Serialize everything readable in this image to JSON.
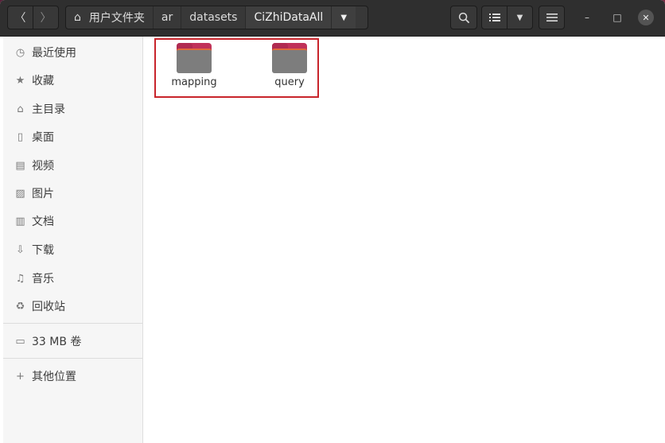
{
  "window": {
    "nav": {
      "back_icon": "chevron-left-icon",
      "forward_icon": "chevron-right-icon"
    },
    "pathbar": {
      "crumbs": [
        {
          "label": "用户文件夹",
          "icon": "home-icon"
        },
        {
          "label": "ar"
        },
        {
          "label": "datasets"
        },
        {
          "label": "CiZhiDataAll"
        }
      ],
      "dropdown_icon": "chevron-down-icon"
    },
    "toolbar": {
      "search_icon": "search-icon",
      "view_icon": "list-view-icon",
      "view_dropdown_icon": "chevron-down-icon",
      "menu_icon": "hamburger-menu-icon"
    },
    "controls": {
      "minimize": "–",
      "maximize": "□",
      "close": "✕"
    }
  },
  "sidebar": {
    "items": [
      {
        "label": "最近使用",
        "icon": "clock-icon"
      },
      {
        "label": "收藏",
        "icon": "star-icon"
      },
      {
        "label": "主目录",
        "icon": "home-icon"
      },
      {
        "label": "桌面",
        "icon": "desktop-icon"
      },
      {
        "label": "视频",
        "icon": "video-icon"
      },
      {
        "label": "图片",
        "icon": "image-icon"
      },
      {
        "label": "文档",
        "icon": "document-icon"
      },
      {
        "label": "下载",
        "icon": "download-icon"
      },
      {
        "label": "音乐",
        "icon": "music-icon"
      },
      {
        "label": "回收站",
        "icon": "trash-icon"
      }
    ],
    "volume": {
      "label": "33 MB 卷",
      "icon": "drive-icon"
    },
    "other": {
      "label": "其他位置",
      "icon": "plus-icon"
    }
  },
  "content": {
    "folders": [
      {
        "name": "mapping",
        "icon": "folder-icon"
      },
      {
        "name": "query",
        "icon": "folder-icon"
      }
    ]
  },
  "colors": {
    "headerbar": "#2f2f2f",
    "folder_accent": "#c0325a",
    "folder_body": "#7d7d7d",
    "selection_box": "#c8242b"
  }
}
